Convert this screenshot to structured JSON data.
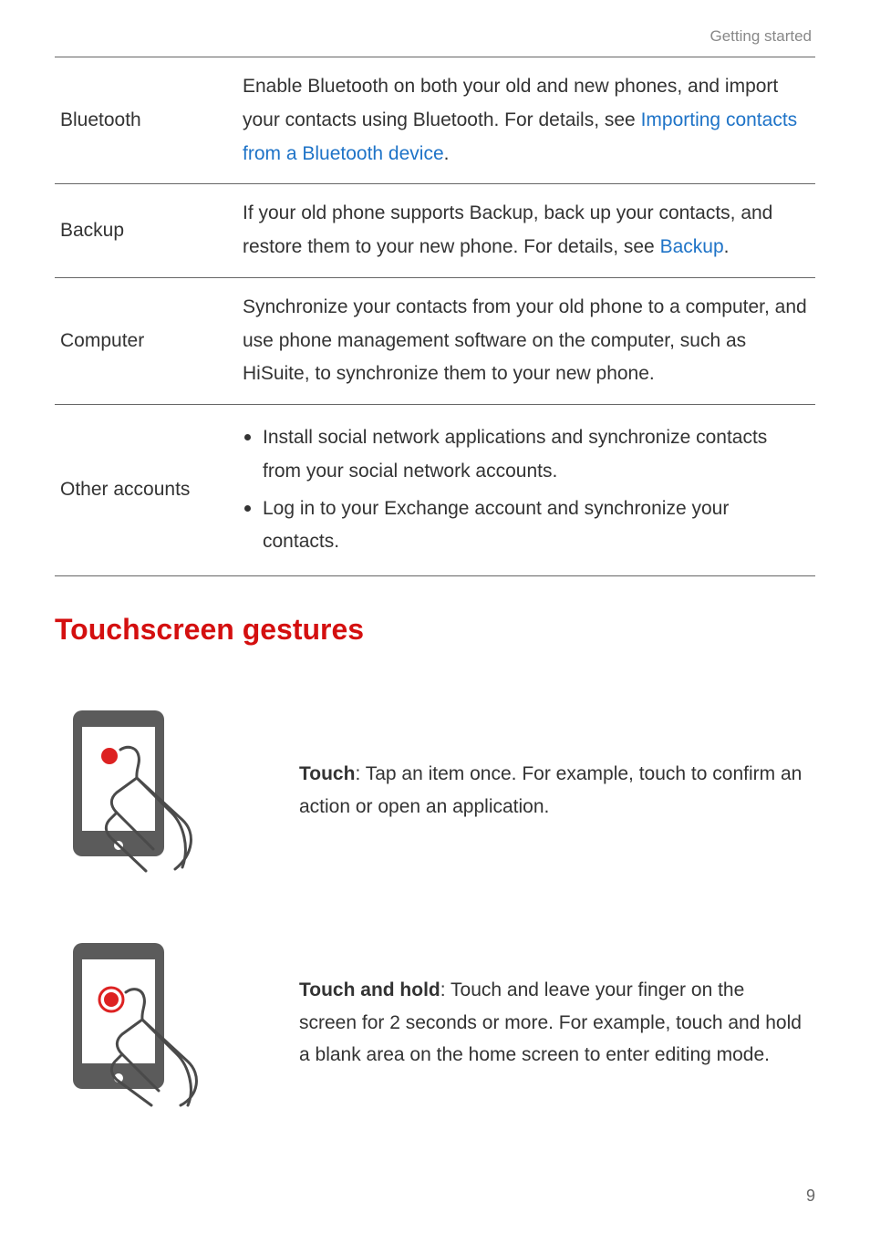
{
  "header": {
    "section_label": "Getting started"
  },
  "table": {
    "rows": [
      {
        "label": "Bluetooth",
        "desc_pre": "Enable Bluetooth on both your old and new phones, and import your contacts using Bluetooth. For details, see ",
        "link": "Importing contacts from a Bluetooth device",
        "desc_post": "."
      },
      {
        "label": "Backup",
        "desc_pre": "If your old phone supports Backup, back up your contacts, and restore them to your new phone. For details, see ",
        "link": "Backup",
        "desc_post": "."
      },
      {
        "label": "Computer",
        "desc_pre": "Synchronize your contacts from your old phone to a computer, and use phone management software on the computer, such as HiSuite, to synchronize them to your new phone.",
        "link": "",
        "desc_post": ""
      },
      {
        "label": "Other accounts",
        "bullets": [
          "Install social network applications and synchronize contacts from your social network accounts.",
          "Log in to your Exchange account and synchronize your contacts."
        ]
      }
    ]
  },
  "heading": "Touchscreen gestures",
  "gestures": [
    {
      "bold": "Touch",
      "text": ": Tap an item once. For example, touch to confirm an action or open an application."
    },
    {
      "bold": "Touch and hold",
      "text": ": Touch and leave your finger on the screen for 2 seconds or more. For example, touch and hold a blank area on the home screen to enter editing mode."
    }
  ],
  "page_number": "9"
}
